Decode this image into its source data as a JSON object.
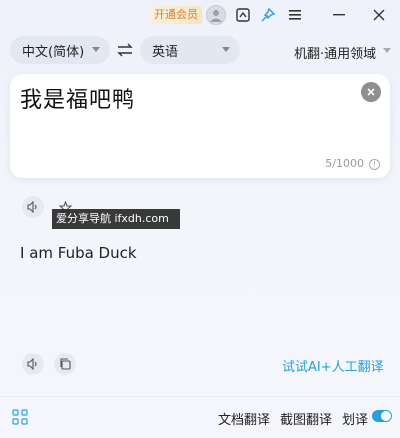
{
  "titlebar": {
    "vip_label": "开通会员",
    "icons": [
      "avatar-icon",
      "screenshot-icon",
      "pin-icon",
      "menu-icon",
      "minimize-icon",
      "close-icon"
    ]
  },
  "languages": {
    "source": "中文(简体)",
    "target": "英语",
    "engine": "机翻·通用领域"
  },
  "source": {
    "text": "我是福吧鸭",
    "count": "5/1000"
  },
  "watermark": "爱分享导航 ifxdh.com",
  "result": {
    "text": "I am Fuba Duck",
    "ai_link": "试试AI+人工翻译"
  },
  "bottom": {
    "doc_translate": "文档翻译",
    "screenshot_translate": "截图翻译",
    "select_translate": "划译",
    "select_translate_enabled": true
  },
  "colors": {
    "accent": "#2aa0d8",
    "vip": "#c48a3c"
  }
}
